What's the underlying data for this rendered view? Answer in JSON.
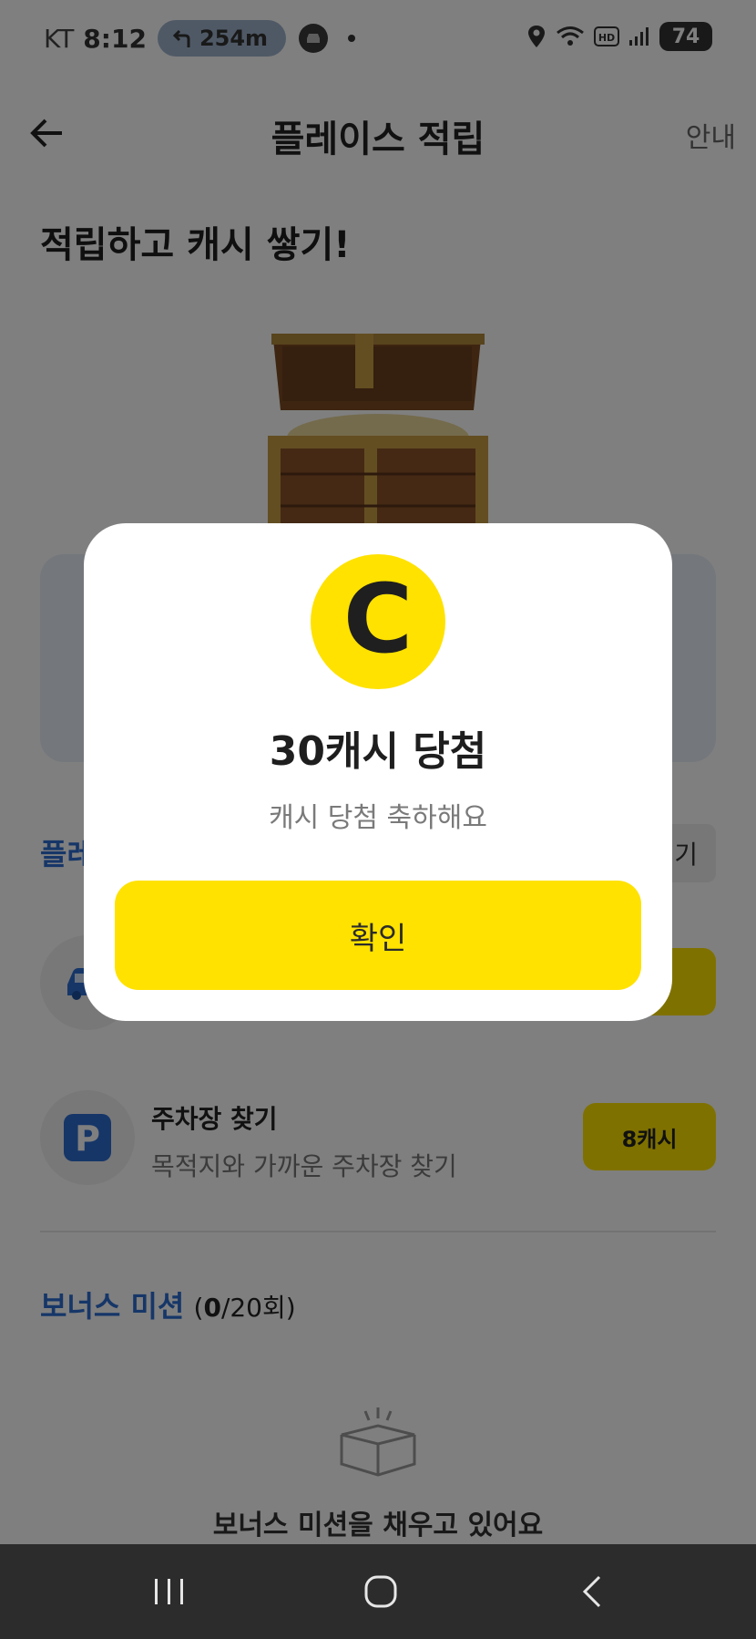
{
  "status_bar": {
    "carrier": "KT",
    "time": "8:12",
    "nav_distance": "254m",
    "battery": "74",
    "icons": [
      "turn-left-icon",
      "car-drive-icon",
      "location-pin-icon",
      "wifi-icon",
      "hd-icon",
      "signal-icon",
      "battery-charging-icon"
    ]
  },
  "header": {
    "title": "플레이스 적립",
    "guide": "안내",
    "back_icon": "back-arrow-icon"
  },
  "headline": "적립하고 캐시 쌓기!",
  "section": {
    "title_visible": "플레",
    "sort_visible": "기"
  },
  "missions": [
    {
      "title": "",
      "subtitle": "",
      "reward": "",
      "icon": "car-icon"
    },
    {
      "title": "주차장 찾기",
      "subtitle": "목적지와 가까운 주차장 찾기",
      "reward": "8캐시",
      "icon": "parking-icon"
    }
  ],
  "bonus": {
    "label": "보너스 미션",
    "count_open": "(",
    "count_done": "0",
    "count_rest": "/20회)"
  },
  "empty_state": {
    "text": "보너스 미션을 채우고 있어요",
    "icon": "empty-box-icon"
  },
  "modal": {
    "coin_letter": "C",
    "title": "30캐시 당첨",
    "subtitle": "캐시 당첨 축하해요",
    "confirm": "확인"
  },
  "colors": {
    "accent_yellow": "#ffe200",
    "link_blue": "#2d6dd1",
    "overlay": "rgba(0,0,0,0.5)"
  }
}
